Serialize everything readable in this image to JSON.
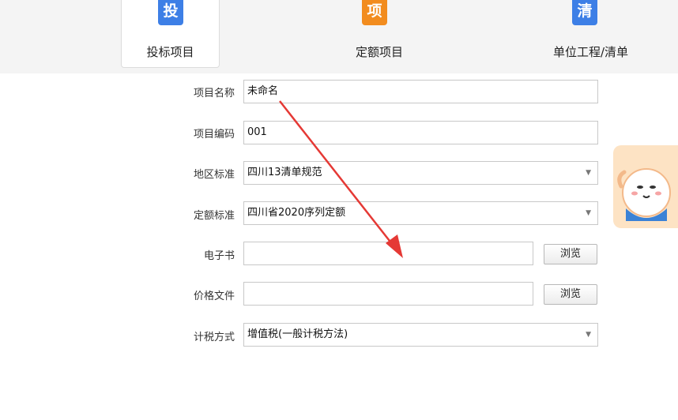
{
  "tabs": [
    {
      "label": "投标项目",
      "icon_char": "投",
      "icon_color": "#3d7fe6",
      "active": true
    },
    {
      "label": "定额项目",
      "icon_char": "项",
      "icon_color": "#f28c1e",
      "active": false
    },
    {
      "label": "单位工程/清单",
      "icon_char": "清",
      "icon_color": "#3d7fe6",
      "active": false
    }
  ],
  "form": {
    "project_name": {
      "label": "项目名称",
      "value": "未命名"
    },
    "project_code": {
      "label": "项目编码",
      "value": "001"
    },
    "region_standard": {
      "label": "地区标准",
      "value": "四川13清单规范"
    },
    "quota_standard": {
      "label": "定额标准",
      "value": "四川省2020序列定额"
    },
    "ebook": {
      "label": "电子书",
      "value": "",
      "browse_label": "浏览"
    },
    "price_file": {
      "label": "价格文件",
      "value": "",
      "browse_label": "浏览"
    },
    "tax_method": {
      "label": "计税方式",
      "value": "增值税(一般计税方法)"
    }
  },
  "icons": {
    "dropdown": "caret-down-icon",
    "assistant": "mascot-assistant-icon"
  },
  "colors": {
    "annotation_arrow": "#e53935",
    "assistant_bg": "#fde3c4"
  }
}
